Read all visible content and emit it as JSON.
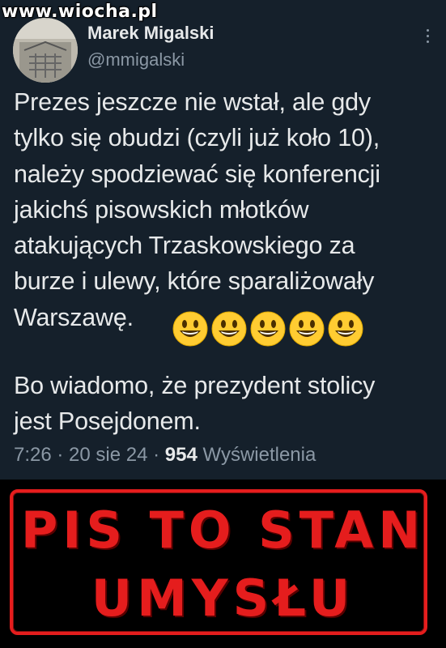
{
  "watermark": "www.wiocha.pl",
  "author": {
    "name": "Marek Migalski",
    "handle": "@mmigalski"
  },
  "tweet": {
    "lines": [
      "Prezes jeszcze nie wstał, ale gdy",
      "tylko się obudzi (czyli już koło 10),",
      "należy spodziewać się konferencji",
      "jakichś pisowskich młotków",
      "atakujących Trzaskowskiego za",
      "burze i ulewy, które sparaliżowały",
      "Warszawę."
    ],
    "emojis": [
      "grinning-face-icon",
      "grinning-face-icon",
      "grinning-face-icon",
      "grinning-face-icon",
      "grinning-face-icon"
    ],
    "lines2": [
      "Bo wiadomo, że prezydent stolicy",
      "jest Posejdonem."
    ]
  },
  "meta": {
    "time": "7:26",
    "sep1": " · ",
    "date": "20 sie 24",
    "sep2": " · ",
    "views": "954",
    "views_label": " Wyświetlenia"
  },
  "stamp": {
    "line1": "PIS TO STAN",
    "line2": "UMYSŁU",
    "color": "#e51d1d"
  },
  "colors": {
    "background": "#15202b",
    "text": "#e7e9ea",
    "secondary": "#8b98a5"
  }
}
